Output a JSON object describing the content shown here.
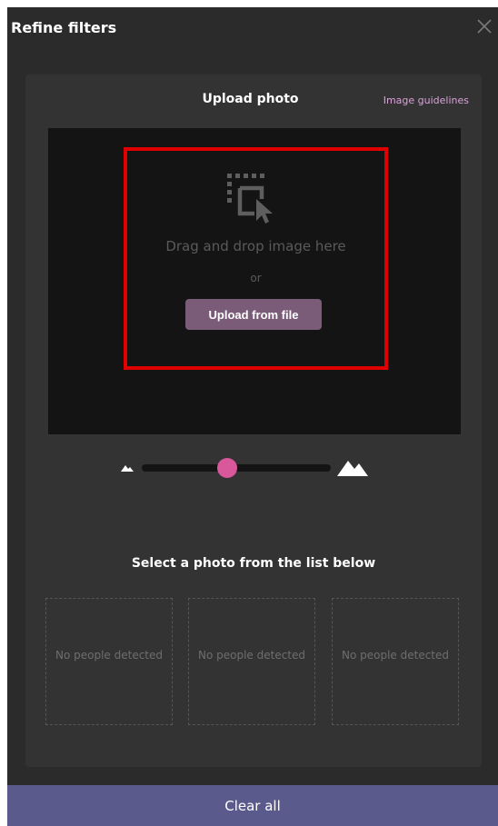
{
  "header": {
    "title": "Refine filters",
    "close_icon": "close-icon"
  },
  "upload": {
    "title": "Upload photo",
    "guidelines_link": "Image guidelines",
    "drop_icon": "drag-drop-cursor-icon",
    "drop_text": "Drag and drop image here",
    "or_text": "or",
    "upload_button": "Upload from file"
  },
  "zoom": {
    "min_icon": "mountain-small-icon",
    "max_icon": "mountain-large-icon",
    "value": 0.45
  },
  "select_section": {
    "title": "Select a photo from the list below",
    "tiles": [
      {
        "label": "No people detected"
      },
      {
        "label": "No people detected"
      },
      {
        "label": "No people detected"
      }
    ]
  },
  "footer": {
    "clear_all": "Clear all"
  },
  "colors": {
    "panel_bg": "#2b2b2b",
    "highlight_border": "#e00000",
    "upload_button_bg": "#7a5c78",
    "slider_thumb": "#d9579b",
    "guidelines_link": "#d9a2d9",
    "clear_button_bg": "#5b5a8c"
  }
}
